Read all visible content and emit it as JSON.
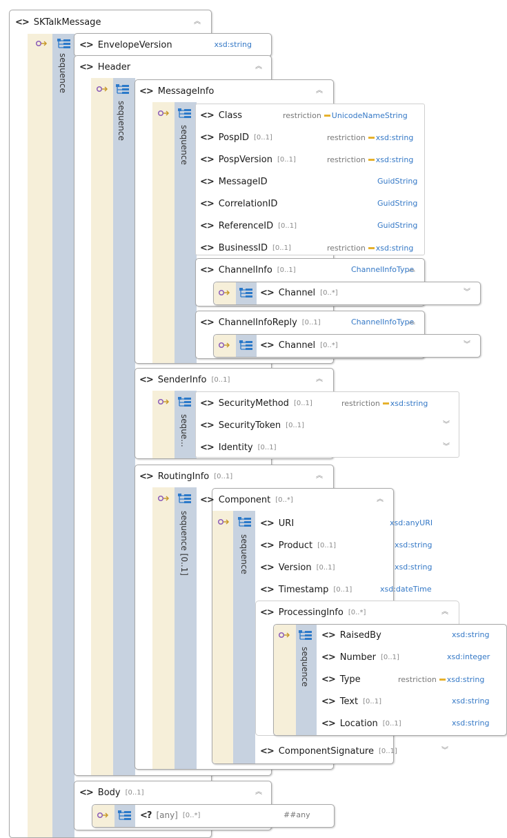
{
  "elements": {
    "sktalkmessage": "SKTalkMessage",
    "envelope_version": {
      "name": "EnvelopeVersion",
      "type": "xsd:string"
    },
    "header": "Header",
    "messageinfo": "MessageInfo",
    "class": {
      "name": "Class",
      "restriction": "restriction",
      "type": "UnicodeNameString"
    },
    "pospid": {
      "name": "PospID",
      "card": "[0..1]",
      "restriction": "restriction",
      "type": "xsd:string"
    },
    "pospversion": {
      "name": "PospVersion",
      "card": "[0..1]",
      "restriction": "restriction",
      "type": "xsd:string"
    },
    "messageid": {
      "name": "MessageID",
      "type": "GuidString"
    },
    "correlationid": {
      "name": "CorrelationID",
      "type": "GuidString"
    },
    "referenceid": {
      "name": "ReferenceID",
      "card": "[0..1]",
      "type": "GuidString"
    },
    "businessid": {
      "name": "BusinessID",
      "card": "[0..1]",
      "restriction": "restriction",
      "type": "xsd:string"
    },
    "channelinfo": {
      "name": "ChannelInfo",
      "card": "[0..1]",
      "type": "ChannelInfoType"
    },
    "channel1": {
      "name": "Channel",
      "card": "[0..*]"
    },
    "channelinforeply": {
      "name": "ChannelInfoReply",
      "card": "[0..1]",
      "type": "ChannelInfoType"
    },
    "channel2": {
      "name": "Channel",
      "card": "[0..*]"
    },
    "senderinfo": {
      "name": "SenderInfo",
      "card": "[0..1]"
    },
    "securitymethod": {
      "name": "SecurityMethod",
      "card": "[0..1]",
      "restriction": "restriction",
      "type": "xsd:string"
    },
    "securitytoken": {
      "name": "SecurityToken",
      "card": "[0..1]"
    },
    "identity": {
      "name": "Identity",
      "card": "[0..1]"
    },
    "routinginfo": {
      "name": "RoutingInfo",
      "card": "[0..1]"
    },
    "component": {
      "name": "Component",
      "card": "[0..*]"
    },
    "uri": {
      "name": "URI",
      "type": "xsd:anyURI"
    },
    "product": {
      "name": "Product",
      "card": "[0..1]",
      "type": "xsd:string"
    },
    "version": {
      "name": "Version",
      "card": "[0..1]",
      "type": "xsd:string"
    },
    "timestamp": {
      "name": "Timestamp",
      "card": "[0..1]",
      "type": "xsd:dateTime"
    },
    "processinginfo": {
      "name": "ProcessingInfo",
      "card": "[0..*]"
    },
    "raisedby": {
      "name": "RaisedBy",
      "type": "xsd:string"
    },
    "number": {
      "name": "Number",
      "card": "[0..1]",
      "type": "xsd:integer"
    },
    "type": {
      "name": "Type",
      "restriction": "restriction",
      "type": "xsd:string"
    },
    "text": {
      "name": "Text",
      "card": "[0..1]",
      "type": "xsd:string"
    },
    "location": {
      "name": "Location",
      "card": "[0..1]",
      "type": "xsd:string"
    },
    "componentsignature": {
      "name": "ComponentSignature",
      "card": "[0..1]"
    },
    "body": {
      "name": "Body",
      "card": "[0..1]"
    },
    "any": {
      "name": "[any]",
      "card": "[0..*]",
      "type": "##any"
    }
  },
  "labels": {
    "sequence": "sequence",
    "seque_trunc": "seque...",
    "sequence_opt": "sequence [0..1]"
  },
  "icons": {
    "element": "element-icon",
    "sequence_order": "sequence-order-icon",
    "sequence_tree": "sequence-tree-icon",
    "expand": "expand-chevron-icon",
    "collapse": "collapse-chevron-icon"
  },
  "colors": {
    "type_text": "#3478c6",
    "restriction_bar": "#e6b12c",
    "sequence_band": "#c7d2e0",
    "cream_band": "#f6efd9"
  }
}
